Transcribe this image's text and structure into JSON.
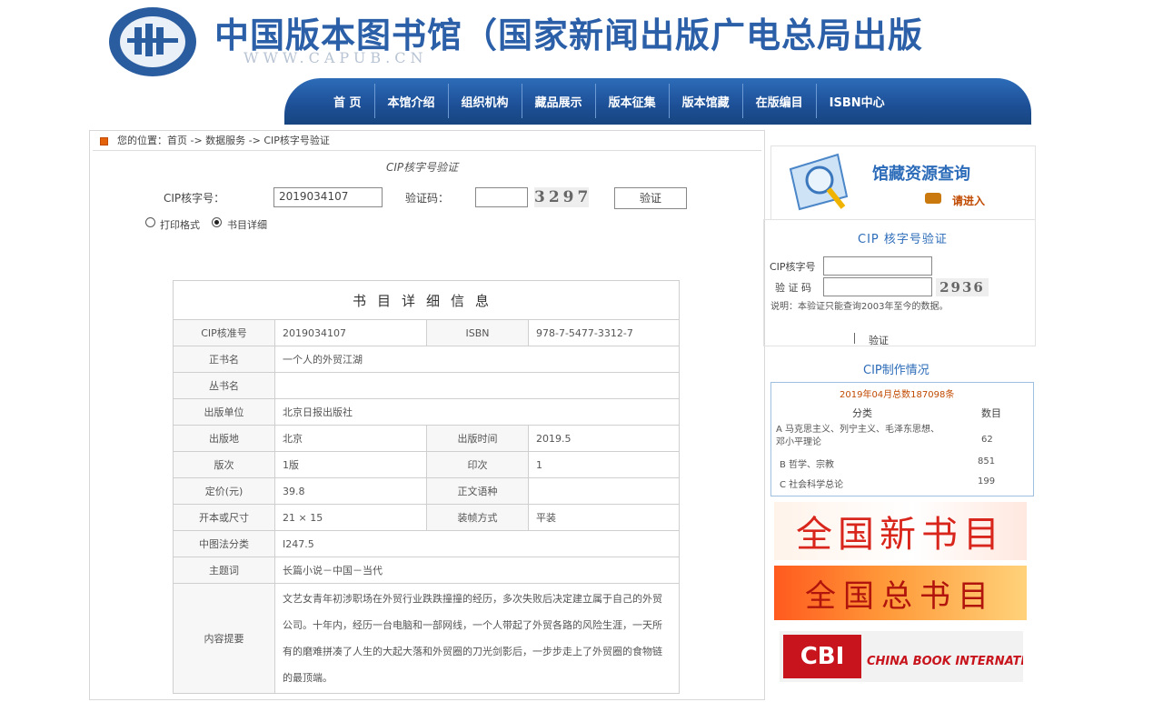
{
  "header": {
    "title": "中国版本图书馆（国家新闻出版广电总局出版",
    "url": "WWW.CAPUB.CN"
  },
  "nav": [
    "首 页",
    "本馆介绍",
    "组织机构",
    "藏品展示",
    "版本征集",
    "版本馆藏",
    "在版编目",
    "ISBN中心"
  ],
  "breadcrumb": "您的位置：首页 -> 数据服务 -> CIP核字号验证",
  "form": {
    "title": "CIP核字号验证",
    "cip_label": "CIP核字号：",
    "cip_value": "2019034107",
    "code_label": "验证码：",
    "code_value": "",
    "captcha": "3297",
    "submit": "验证",
    "radio_print": "打印格式",
    "radio_detail": "书目详细",
    "selected": "detail"
  },
  "detail": {
    "heading": "书目详细信息",
    "rows": {
      "cip_no_label": "CIP核准号",
      "cip_no": "2019034107",
      "isbn_label": "ISBN",
      "isbn": "978-7-5477-3312-7",
      "title_label": "正书名",
      "title": "一个人的外贸江湖",
      "series_label": "丛书名",
      "series": "",
      "publisher_label": "出版单位",
      "publisher": "北京日报出版社",
      "place_label": "出版地",
      "place": "北京",
      "pubtime_label": "出版时间",
      "pubtime": "2019.5",
      "edition_label": "版次",
      "edition": "1版",
      "printing_label": "印次",
      "printing": "1",
      "price_label": "定价(元)",
      "price": "39.8",
      "lang_label": "正文语种",
      "lang": "",
      "size_label": "开本或尺寸",
      "size": "21 × 15",
      "binding_label": "装帧方式",
      "binding": "平装",
      "clc_label": "中图法分类",
      "clc": "I247.5",
      "subject_label": "主题词",
      "subject": "长篇小说－中国－当代",
      "summary_label": "内容提要",
      "summary": "文艺女青年初涉职场在外贸行业跌跌撞撞的经历，多次失败后决定建立属于自己的外贸公司。十年内，经历一台电脑和一部网线，一个人带起了外贸各路的风险生涯，一天所有的磨难拼凑了人生的大起大落和外贸圈的刀光剑影后，一步步走上了外贸圈的食物链的最顶端。"
    }
  },
  "sidebar": {
    "search_title": "馆藏资源查询",
    "search_link": "请进入",
    "verify_title": "CIP 核字号验证",
    "verify_cip_label": "CIP核字号",
    "verify_code_label": "验 证 码",
    "verify_captcha": "2936",
    "verify_note": "说明：本验证只能查询2003年至今的数据。",
    "verify_button": "验证",
    "stats_title": "CIP制作情况",
    "stats_subtitle": "2019年04月总数187098条",
    "stats_col1": "分类",
    "stats_col2": "数目",
    "stats_rows": [
      {
        "name": "A 马克思主义、列宁主义、毛泽东思想、邓小平理论",
        "count": "62"
      },
      {
        "name": "B 哲学、宗教",
        "count": "851"
      },
      {
        "name": "C 社会科学总论",
        "count": "199"
      }
    ],
    "banner1": "全国新书目",
    "banner2": "全国总书目",
    "banner3_main": "CBI",
    "banner3_sub": "CHINA BOOK INTERNATIONAL"
  },
  "colors": {
    "brand_blue": "#2b5fa8",
    "nav_blue": "#1d4f96",
    "banner_red": "#d9261c"
  }
}
